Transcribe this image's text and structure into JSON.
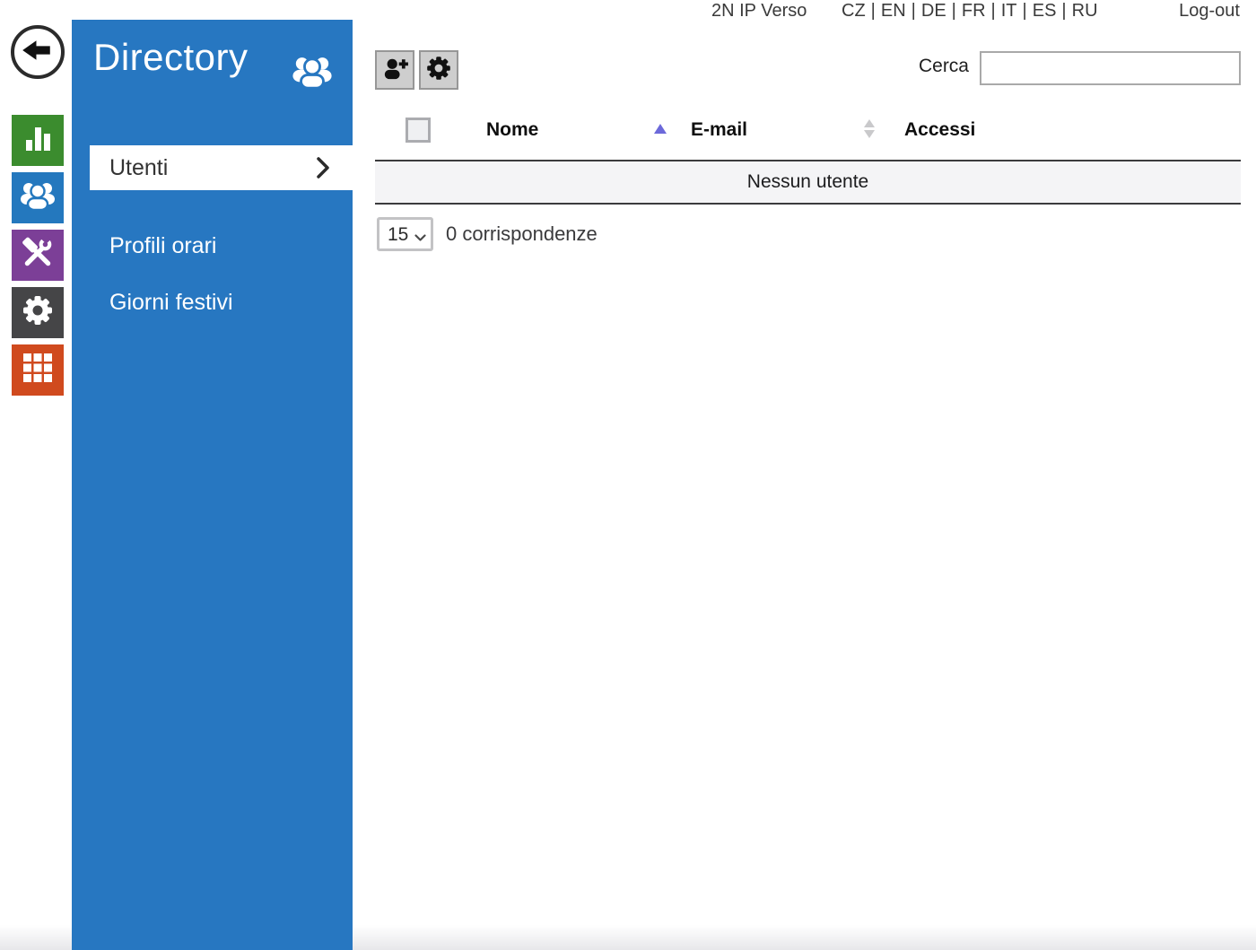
{
  "topbar": {
    "product": "2N IP Verso",
    "languages": [
      "CZ",
      "EN",
      "DE",
      "FR",
      "IT",
      "ES",
      "RU"
    ],
    "separator": "|",
    "logout": "Log-out"
  },
  "rail": {
    "icons": [
      {
        "name": "back-arrow",
        "color": "#ffffff"
      },
      {
        "name": "state-bar-chart",
        "color": "#3b8c2e"
      },
      {
        "name": "directory-users",
        "color": "#2478be"
      },
      {
        "name": "services-tools",
        "color": "#7c3f97"
      },
      {
        "name": "hardware-gear",
        "color": "#454547"
      },
      {
        "name": "system-grid",
        "color": "#d04a1e"
      }
    ]
  },
  "panel": {
    "title": "Directory",
    "accent_color": "#2777c1",
    "items": [
      {
        "label": "Utenti",
        "active": true
      },
      {
        "label": "Profili orari",
        "active": false
      },
      {
        "label": "Giorni festivi",
        "active": false
      }
    ]
  },
  "toolbar": {
    "add_user_icon": "person-plus",
    "settings_icon": "gear"
  },
  "search": {
    "label": "Cerca",
    "value": "",
    "placeholder": ""
  },
  "table": {
    "columns": [
      "Nome",
      "E-mail",
      "Accessi"
    ],
    "sort": {
      "column": "Nome",
      "direction": "asc",
      "asc_color": "#6c69da",
      "idle_color": "#c9c9cb"
    },
    "empty_text": "Nessun utente"
  },
  "pagination": {
    "page_size": "15",
    "matches_text": "0 corrispondenze"
  }
}
